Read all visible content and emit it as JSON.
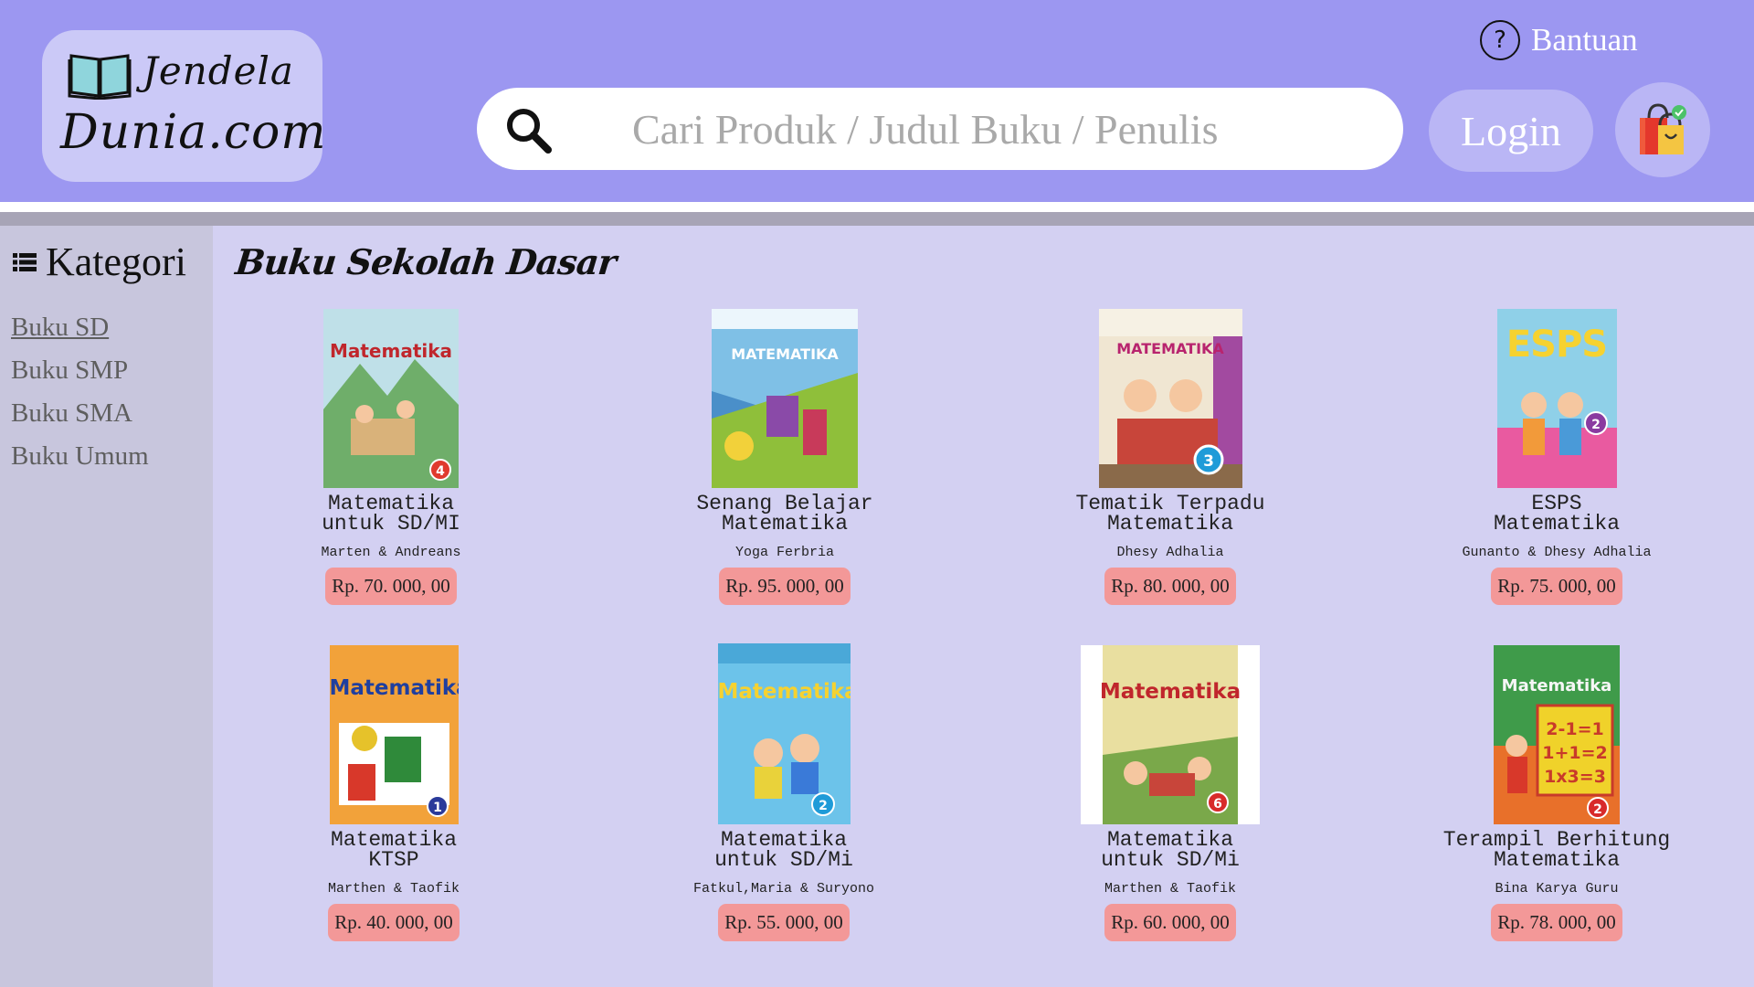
{
  "header": {
    "logo_line1": "Jendela",
    "logo_line2": "Dunia.com",
    "help_label": "Bantuan",
    "search_placeholder": "Cari Produk / Judul Buku / Penulis",
    "login_label": "Login"
  },
  "sidebar": {
    "title": "Kategori",
    "items": [
      {
        "label": "Buku SD",
        "active": true
      },
      {
        "label": "Buku SMP",
        "active": false
      },
      {
        "label": "Buku SMA",
        "active": false
      },
      {
        "label": "Buku Umum",
        "active": false
      }
    ]
  },
  "main": {
    "section_title": "Buku Sekolah Dasar",
    "books": [
      {
        "title_l1": "Matematika",
        "title_l2": "untuk SD/MI",
        "author": "Marten & Andreans",
        "price": "Rp. 70. 000, 00",
        "cover_title": "Matematika",
        "cover_color": "#9cc8a8",
        "badge": "4"
      },
      {
        "title_l1": "Senang Belajar",
        "title_l2": "Matematika",
        "author": "Yoga Ferbria",
        "price": "Rp. 95. 000, 00",
        "cover_title": "MATEMATIKA",
        "cover_color": "#4a8fc9",
        "badge": ""
      },
      {
        "title_l1": "Tematik Terpadu",
        "title_l2": "Matematika",
        "author": "Dhesy Adhalia",
        "price": "Rp. 80. 000, 00",
        "cover_title": "MATEMATIKA",
        "cover_color": "#f0e6d2",
        "badge": "3"
      },
      {
        "title_l1": "ESPS",
        "title_l2": "Matematika",
        "author": "Gunanto & Dhesy Adhalia",
        "price": "Rp. 75. 000, 00",
        "cover_title": "ESPS",
        "cover_color": "#8fd0e8",
        "badge": "2"
      },
      {
        "title_l1": "Matematika",
        "title_l2": "KTSP",
        "author": "Marthen & Taofik",
        "price": "Rp. 40. 000, 00",
        "cover_title": "Matematika",
        "cover_color": "#f2a23a",
        "badge": "1"
      },
      {
        "title_l1": "Matematika",
        "title_l2": "untuk SD/Mi",
        "author": "Fatkul,Maria & Suryono",
        "price": "Rp. 55. 000, 00",
        "cover_title": "Matematika",
        "cover_color": "#6cc3ea",
        "badge": "2"
      },
      {
        "title_l1": "Matematika",
        "title_l2": "untuk SD/Mi",
        "author": "Marthen & Taofik",
        "price": "Rp. 60. 000, 00",
        "cover_title": "Matematika",
        "cover_color": "#e9dfa0",
        "badge": "6"
      },
      {
        "title_l1": "Terampil Berhitung",
        "title_l2": "Matematika",
        "author": "Bina Karya Guru",
        "price": "Rp. 78. 000, 00",
        "cover_title": "Matematika",
        "cover_color": "#3f9b4a",
        "badge": "2"
      }
    ]
  },
  "icons": {
    "logo": "open-book-icon",
    "help": "question-circle-icon",
    "search": "magnifier-icon",
    "cart": "shopping-bag-icon",
    "category": "list-icon"
  },
  "colors": {
    "header_bg": "#9c97f1",
    "main_bg": "#d3d0f2",
    "sidebar_bg": "#c8c6dd",
    "price_bg": "#f39898"
  }
}
